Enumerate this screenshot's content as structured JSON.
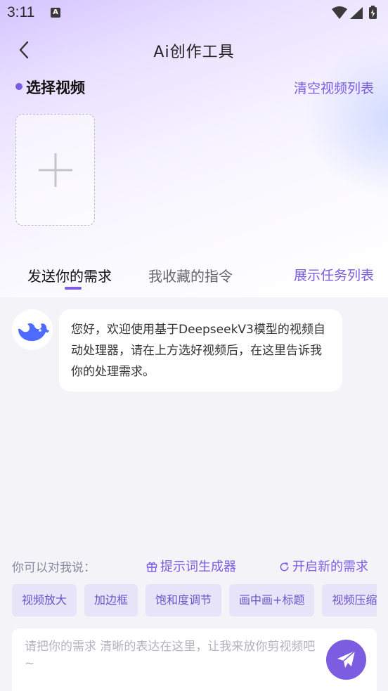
{
  "status_bar": {
    "time": "3:11",
    "notification_icon_letter": "A",
    "icons": [
      "wifi-icon",
      "signal-icon",
      "battery-charging-icon"
    ]
  },
  "header": {
    "title": "Ai创作工具",
    "back_icon": "chevron-left-icon"
  },
  "video_section": {
    "title": "选择视频",
    "clear_label": "清空视频列表",
    "add_icon": "plus-icon"
  },
  "tabs": [
    {
      "label": "发送你的需求",
      "active": true
    },
    {
      "label": "我收藏的指令",
      "active": false
    }
  ],
  "task_list_label": "展示任务列表",
  "chat": {
    "avatar_icon": "deepseek-whale-icon",
    "message": "您好，欢迎使用基于DeepseekV3模型的视频自动处理器，请在上方选好视频后，在这里告诉我你的处理需求。"
  },
  "suggestions": {
    "hint": "你可以对我说：",
    "prompt_generator": "提示词生成器",
    "new_request": "开启新的需求",
    "chips": [
      "视频放大",
      "加边框",
      "饱和度调节",
      "画中画+标题",
      "视频压缩"
    ]
  },
  "input": {
    "placeholder": "请把你的需求 清晰的表达在这里，让我来放你剪视频吧~",
    "send_icon": "paper-plane-icon"
  },
  "colors": {
    "accent": "#7c5ce0",
    "chip_bg": "#e7e3f8",
    "page_bg": "#f3f3f8"
  }
}
